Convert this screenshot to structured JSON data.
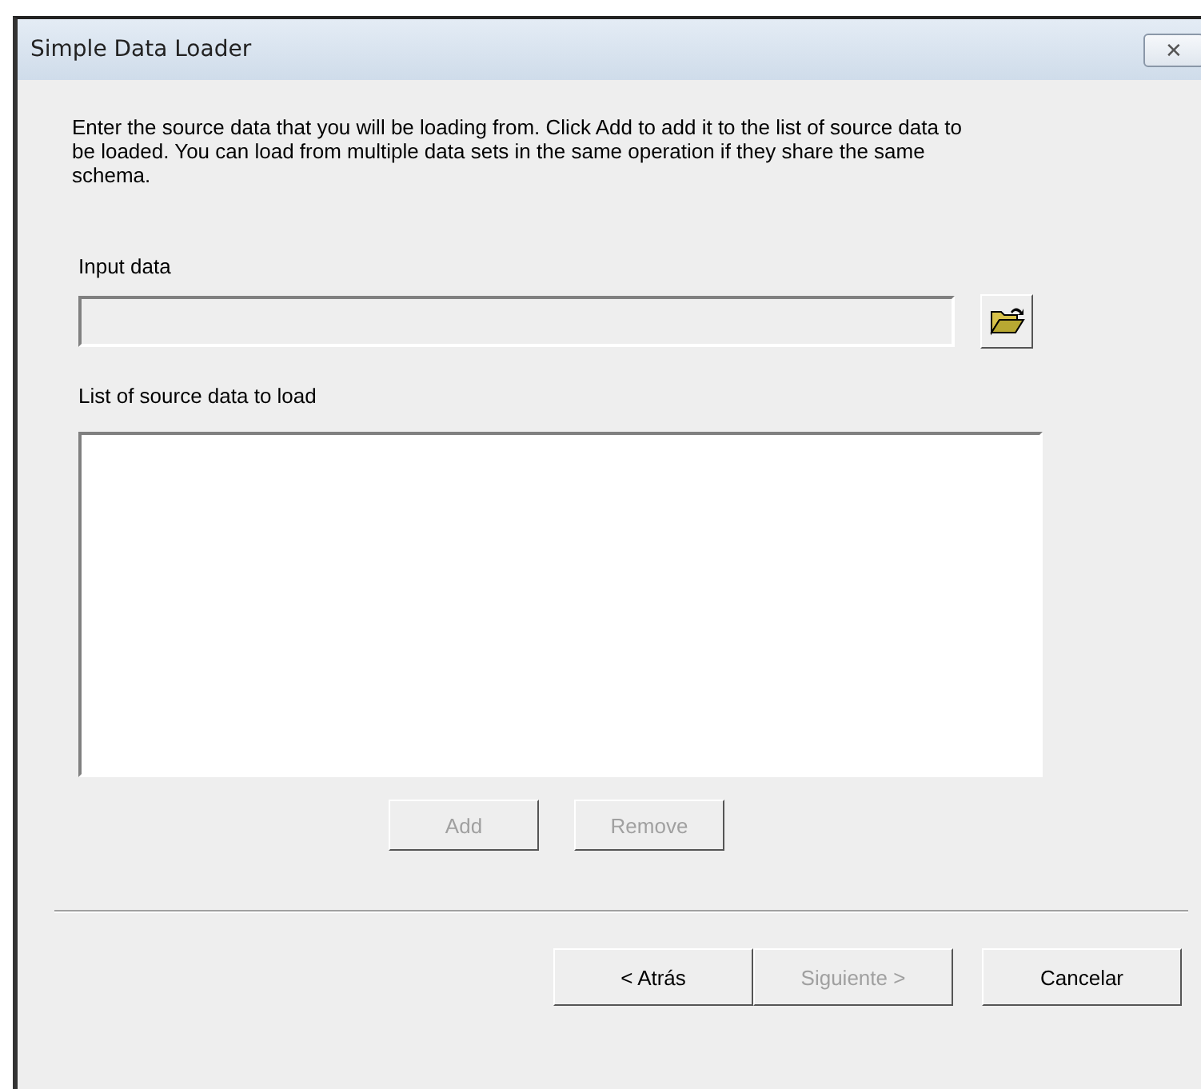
{
  "window": {
    "title": "Simple Data Loader",
    "close": "✕"
  },
  "instructions": "Enter the source data that you will be loading from. Click Add to add it to the list of source data to be loaded. You can load from multiple data sets in the same operation if they share the same schema.",
  "input": {
    "label": "Input data",
    "disabled": true
  },
  "list": {
    "label": "List of source data to load"
  },
  "list_buttons": [
    {
      "label": "Add",
      "disabled": true
    },
    {
      "label": "Remove",
      "disabled": true
    }
  ],
  "footer_buttons": [
    {
      "label": "< Atrás",
      "disabled": false
    },
    {
      "label": "Siguiente >",
      "disabled": true
    },
    {
      "label": "Cancelar",
      "disabled": false
    }
  ]
}
